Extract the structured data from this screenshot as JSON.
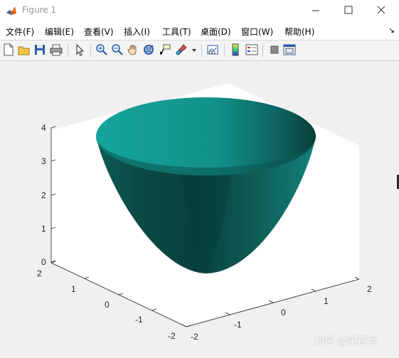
{
  "window": {
    "title": "Figure 1"
  },
  "menu": [
    {
      "label": "文件(F)"
    },
    {
      "label": "编辑(E)"
    },
    {
      "label": "查看(V)"
    },
    {
      "label": "插入(I)"
    },
    {
      "label": "工具(T)"
    },
    {
      "label": "桌面(D)"
    },
    {
      "label": "窗口(W)"
    },
    {
      "label": "帮助(H)"
    }
  ],
  "toolbar": {
    "icons": [
      "new-figure-icon",
      "open-file-icon",
      "save-icon",
      "print-icon",
      "pointer-icon",
      "zoom-in-icon",
      "zoom-out-icon",
      "pan-icon",
      "rotate-3d-icon",
      "data-cursor-icon",
      "brush-icon",
      "dropdown-arrow-icon",
      "link-plot-icon",
      "colorbar-icon",
      "legend-icon",
      "hide-plot-tools-icon",
      "show-plot-tools-icon"
    ]
  },
  "chart_data": {
    "type": "surface",
    "function": "z = x^2 + y^2 (paraboloid, radius 2)",
    "xlim": [
      -2,
      2
    ],
    "ylim": [
      -2,
      2
    ],
    "zlim": [
      0,
      4
    ],
    "x_ticks": [
      "-2",
      "-1",
      "0",
      "1",
      "2"
    ],
    "y_ticks": [
      "-2",
      "-1",
      "0",
      "1",
      "2"
    ],
    "z_ticks": [
      "0",
      "1",
      "2",
      "3",
      "4"
    ],
    "colors": {
      "rim": "#16a29a",
      "shade": "#0b3f3b",
      "axes_bg": "#ffffff",
      "figure_bg": "#f0f0f0"
    },
    "title": "",
    "xlabel": "",
    "ylabel": "",
    "zlabel": ""
  },
  "watermark": "知乎 @采莲兮"
}
